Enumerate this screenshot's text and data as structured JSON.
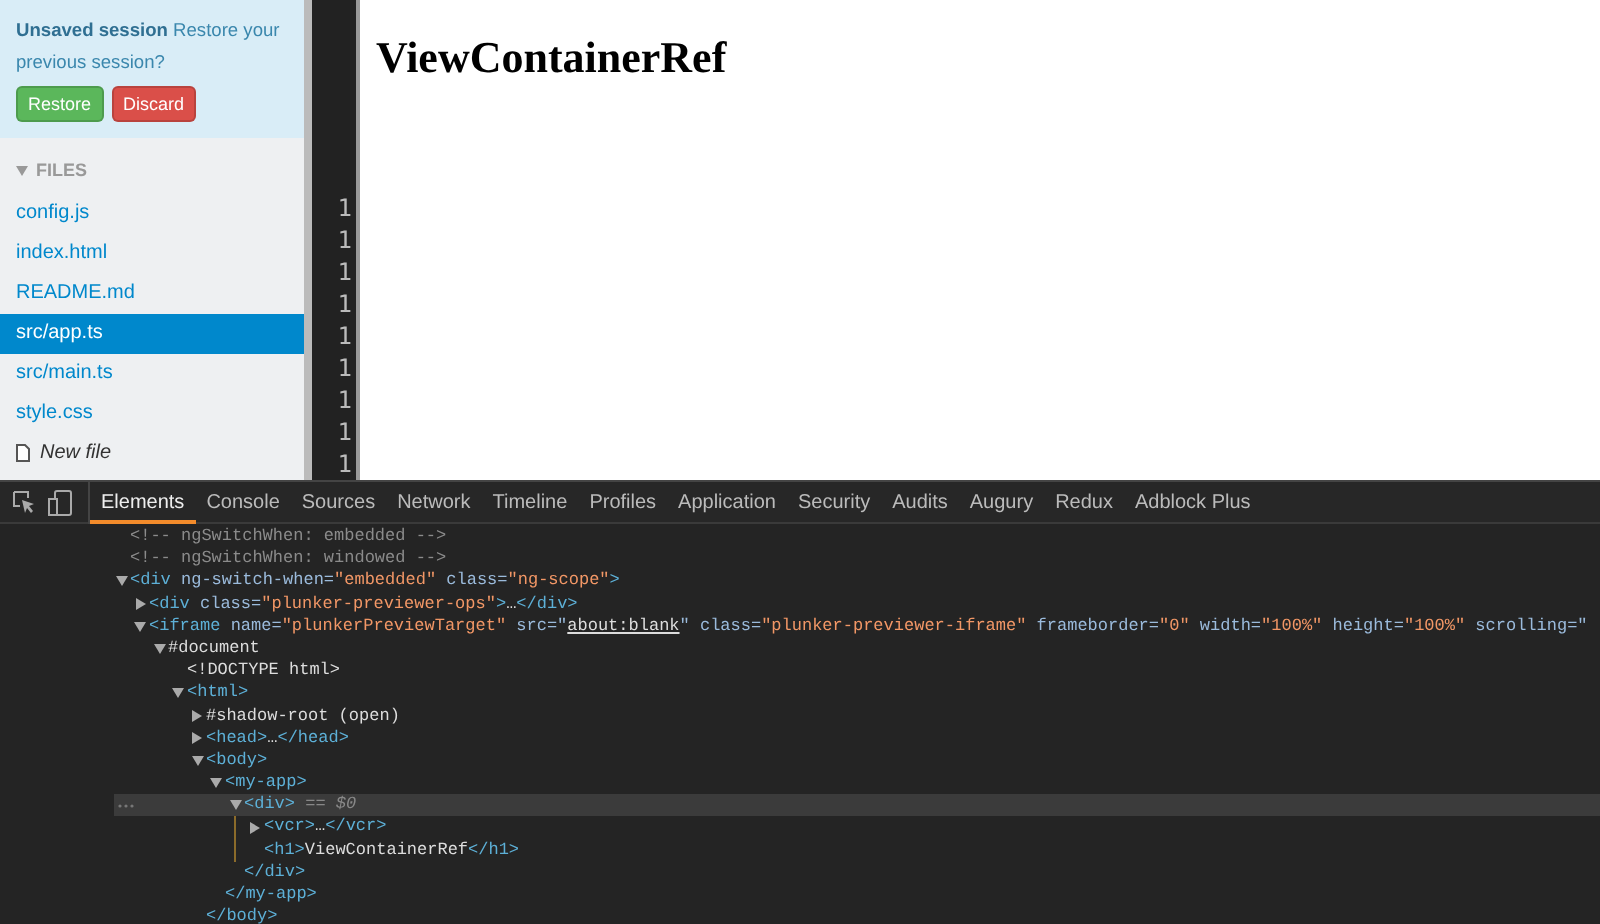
{
  "session_notice": {
    "title": "Unsaved session",
    "message": "Restore your previous session?",
    "buttons": [
      {
        "label": "Restore",
        "kind": "success"
      },
      {
        "label": "Discard",
        "kind": "danger"
      }
    ]
  },
  "files": {
    "header": "FILES",
    "expanded": true,
    "items": [
      {
        "name": "config.js",
        "selected": false
      },
      {
        "name": "index.html",
        "selected": false
      },
      {
        "name": "README.md",
        "selected": false
      },
      {
        "name": "src/app.ts",
        "selected": true
      },
      {
        "name": "src/main.ts",
        "selected": false
      },
      {
        "name": "style.css",
        "selected": false
      }
    ],
    "new_file": "New file"
  },
  "editor": {
    "line_numbers": [
      "1",
      "1",
      "1",
      "1",
      "1",
      "1",
      "1",
      "1",
      "1"
    ]
  },
  "preview": {
    "heading": "ViewContainerRef"
  },
  "devtools": {
    "tabs": [
      {
        "label": "Elements",
        "selected": true
      },
      {
        "label": "Console",
        "selected": false
      },
      {
        "label": "Sources",
        "selected": false
      },
      {
        "label": "Network",
        "selected": false
      },
      {
        "label": "Timeline",
        "selected": false
      },
      {
        "label": "Profiles",
        "selected": false
      },
      {
        "label": "Application",
        "selected": false
      },
      {
        "label": "Security",
        "selected": false
      },
      {
        "label": "Audits",
        "selected": false
      },
      {
        "label": "Augury",
        "selected": false
      },
      {
        "label": "Redux",
        "selected": false
      },
      {
        "label": "Adblock Plus",
        "selected": false
      }
    ],
    "tree": [
      {
        "selected": false,
        "open": [
          {
            "kind": "comment",
            "text": "<!-- ngSwitchWhen: embedded -->"
          }
        ]
      },
      {
        "selected": false,
        "open": [
          {
            "kind": "comment",
            "text": "<!-- ngSwitchWhen: windowed -->"
          }
        ]
      },
      {
        "selected": false,
        "expanded": true,
        "open": [
          {
            "kind": "tag",
            "text": "<div"
          },
          {
            "kind": "attr",
            "text": " ng-switch-when="
          },
          {
            "kind": "val",
            "text": "\"embedded\""
          },
          {
            "kind": "attr",
            "text": " class="
          },
          {
            "kind": "val",
            "text": "\"ng-scope\""
          },
          {
            "kind": "tag",
            "text": ">"
          }
        ],
        "children": [
          {
            "selected": false,
            "expanded": false,
            "open": [
              {
                "kind": "tag",
                "text": "<div"
              },
              {
                "kind": "attr",
                "text": " class="
              },
              {
                "kind": "val",
                "text": "\"plunker-previewer-ops\""
              },
              {
                "kind": "tag",
                "text": ">"
              },
              {
                "kind": "plain",
                "text": "…"
              },
              {
                "kind": "tag",
                "text": "</div>"
              }
            ]
          },
          {
            "selected": false,
            "expanded": true,
            "open": [
              {
                "kind": "tag",
                "text": "<iframe"
              },
              {
                "kind": "attr",
                "text": " name="
              },
              {
                "kind": "val",
                "text": "\"plunkerPreviewTarget\""
              },
              {
                "kind": "attr",
                "text": " src=\""
              },
              {
                "kind": "link",
                "text": "about:blank"
              },
              {
                "kind": "attr",
                "text": "\" class="
              },
              {
                "kind": "val",
                "text": "\"plunker-previewer-iframe\""
              },
              {
                "kind": "attr",
                "text": " frameborder="
              },
              {
                "kind": "val",
                "text": "\"0\""
              },
              {
                "kind": "attr",
                "text": " width="
              },
              {
                "kind": "val",
                "text": "\"100%\""
              },
              {
                "kind": "attr",
                "text": " height="
              },
              {
                "kind": "val",
                "text": "\"100%\""
              },
              {
                "kind": "attr",
                "text": " scrolling=\""
              }
            ],
            "children": [
              {
                "selected": false,
                "expanded": true,
                "open": [
                  {
                    "kind": "plain",
                    "text": "#document"
                  }
                ],
                "children": [
                  {
                    "selected": false,
                    "open": [
                      {
                        "kind": "plain",
                        "text": "<!DOCTYPE html>"
                      }
                    ]
                  },
                  {
                    "selected": false,
                    "expanded": true,
                    "open": [
                      {
                        "kind": "tag",
                        "text": "<html>"
                      }
                    ],
                    "children": [
                      {
                        "selected": false,
                        "expanded": false,
                        "open": [
                          {
                            "kind": "plain",
                            "text": "#shadow-root (open)"
                          }
                        ]
                      },
                      {
                        "selected": false,
                        "expanded": false,
                        "open": [
                          {
                            "kind": "tag",
                            "text": "<head>"
                          },
                          {
                            "kind": "plain",
                            "text": "…"
                          },
                          {
                            "kind": "tag",
                            "text": "</head>"
                          }
                        ]
                      },
                      {
                        "selected": false,
                        "expanded": true,
                        "open": [
                          {
                            "kind": "tag",
                            "text": "<body>"
                          }
                        ],
                        "children": [
                          {
                            "selected": false,
                            "expanded": true,
                            "open": [
                              {
                                "kind": "tag",
                                "text": "<my-app>"
                              }
                            ],
                            "children": [
                              {
                                "selected": true,
                                "expanded": true,
                                "open": [
                                  {
                                    "kind": "tag",
                                    "text": "<div>"
                                  },
                                  {
                                    "kind": "sel",
                                    "text": " == $0"
                                  }
                                ],
                                "children": [
                                  {
                                    "selected": false,
                                    "expanded": false,
                                    "open": [
                                      {
                                        "kind": "tag",
                                        "text": "<vcr>"
                                      },
                                      {
                                        "kind": "plain",
                                        "text": "…"
                                      },
                                      {
                                        "kind": "tag",
                                        "text": "</vcr>"
                                      }
                                    ]
                                  },
                                  {
                                    "selected": false,
                                    "open": [
                                      {
                                        "kind": "tag",
                                        "text": "<h1>"
                                      },
                                      {
                                        "kind": "plain",
                                        "text": "ViewContainerRef"
                                      },
                                      {
                                        "kind": "tag",
                                        "text": "</h1>"
                                      }
                                    ]
                                  }
                                ],
                                "close": [
                                  {
                                    "kind": "tag",
                                    "text": "</div>"
                                  }
                                ]
                              }
                            ],
                            "close": [
                              {
                                "kind": "tag",
                                "text": "</my-app>"
                              }
                            ]
                          }
                        ],
                        "close": [
                          {
                            "kind": "tag",
                            "text": "</body>"
                          }
                        ]
                      }
                    ]
                  }
                ]
              }
            ]
          }
        ]
      }
    ]
  }
}
